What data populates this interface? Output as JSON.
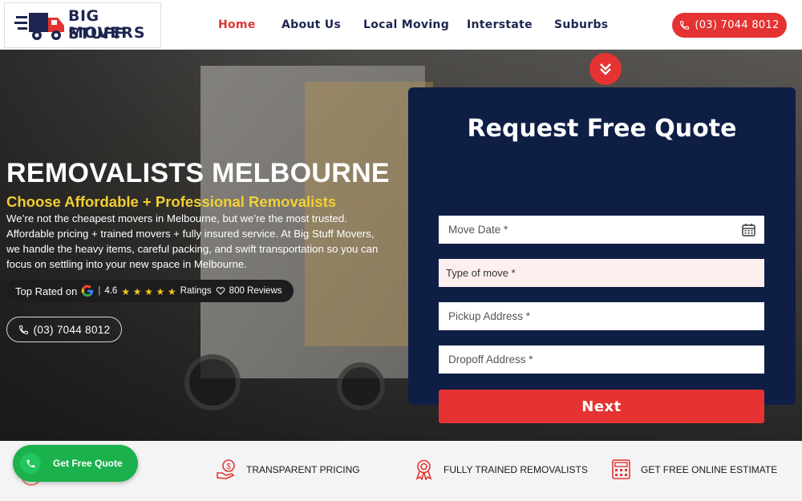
{
  "brand": {
    "line1": "BIG STUFF",
    "line2": "MOVERS"
  },
  "nav": {
    "items": [
      {
        "label": "Home",
        "active": true
      },
      {
        "label": "About Us",
        "active": false
      },
      {
        "label": "Local Moving",
        "active": false
      },
      {
        "label": "Interstate",
        "active": false
      },
      {
        "label": "Suburbs",
        "active": false
      }
    ],
    "phone": "(03) 7044 8012"
  },
  "hero": {
    "title": "REMOVALISTS MELBOURNE",
    "subtitle": "Choose Affordable + Professional Removalists",
    "description": "We’re not the cheapest movers in Melbourne, but we’re the most trusted. Affordable pricing + trained movers + fully insured service. At Big Stuff Movers, we handle the heavy items, careful packing, and swift transportation so you can focus on settling into your new space in Melbourne.",
    "rating": {
      "prefix": "Top Rated on",
      "score": "4.6",
      "stars": 5,
      "ratings_label": "Ratings",
      "reviews_label": "800 Reviews"
    },
    "phone": "(03) 7044 8012"
  },
  "quote_form": {
    "title": "Request Free Quote",
    "fields": {
      "move_date": "Move Date *",
      "type_of_move": "Type of move *",
      "pickup": "Pickup Address *",
      "dropoff": "Dropoff Address *"
    },
    "submit_label": "Next"
  },
  "features": [
    {
      "label": "TRANSPARENT PRICING",
      "icon": "dollar-hand-icon"
    },
    {
      "label": "FULLY TRAINED REMOVALISTS",
      "icon": "award-ribbon-icon"
    },
    {
      "label": "GET FREE ONLINE ESTIMATE",
      "icon": "calculator-icon"
    }
  ],
  "floating_cta": {
    "label": "Get Free Quote",
    "icon": "phone-icon"
  },
  "colors": {
    "accent_red": "#e53232",
    "navy": "#0f1e45",
    "yellow": "#f2cf33",
    "green": "#1bb14c"
  }
}
